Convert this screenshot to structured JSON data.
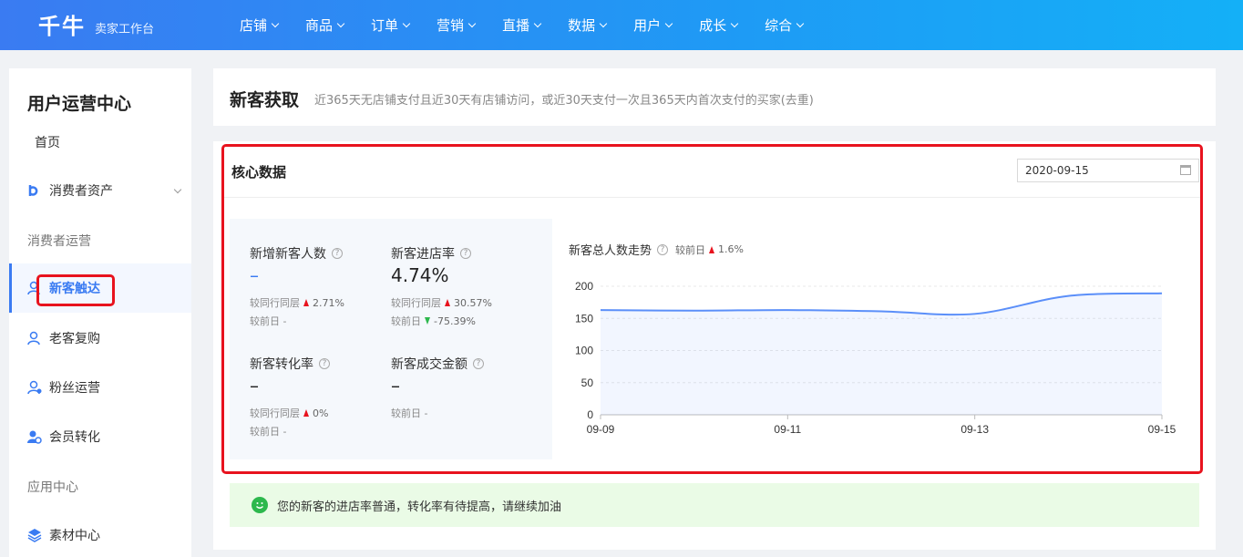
{
  "topbar": {
    "logo": "千牛",
    "logo_sub": "卖家工作台",
    "nav": [
      "店铺",
      "商品",
      "订单",
      "营销",
      "直播",
      "数据",
      "用户",
      "成长",
      "综合"
    ]
  },
  "sidebar": {
    "title": "用户运营中心",
    "home": "首页",
    "consumer_assets": "消费者资产",
    "section_consumer_ops": "消费者运营",
    "items": [
      "新客触达",
      "老客复购",
      "粉丝运营",
      "会员转化"
    ],
    "section_apps": "应用中心",
    "material_center": "素材中心"
  },
  "header": {
    "title": "新客获取",
    "desc": "近365天无店铺支付且近30天有店铺访问，或近30天支付一次且365天内首次支付的买家(去重)"
  },
  "core": {
    "title": "核心数据",
    "date": "2020-09-15",
    "metrics": {
      "new_customers": {
        "label": "新增新客人数",
        "value": "–",
        "peer": "较同行同层",
        "peer_val": "2.71%",
        "day": "较前日 -"
      },
      "visit_rate": {
        "label": "新客进店率",
        "value": "4.74%",
        "peer": "较同行同层",
        "peer_val": "30.57%",
        "day": "较前日",
        "day_val": "-75.39%"
      },
      "conversion": {
        "label": "新客转化率",
        "value": "–",
        "peer": "较同行同层",
        "peer_val": "0%",
        "day": "较前日 -"
      },
      "amount": {
        "label": "新客成交金额",
        "value": "–",
        "day": "较前日 -"
      }
    },
    "trend": {
      "label": "新客总人数走势",
      "cmp": "较前日",
      "cmp_val": "1.6%"
    }
  },
  "chart_data": {
    "type": "area",
    "x": [
      "09-09",
      "09-10",
      "09-11",
      "09-12",
      "09-13",
      "09-14",
      "09-15"
    ],
    "series": [
      {
        "values": [
          163,
          162,
          163,
          161,
          157,
          185,
          189
        ]
      }
    ],
    "ylim": [
      0,
      200
    ],
    "yticks": [
      0,
      50,
      100,
      150,
      200
    ],
    "xtick_labels": [
      "09-09",
      "09-11",
      "09-13",
      "09-15"
    ],
    "color": "#5b8ff9"
  },
  "tip": "您的新客的进店率普通，转化率有待提高，请继续加油"
}
